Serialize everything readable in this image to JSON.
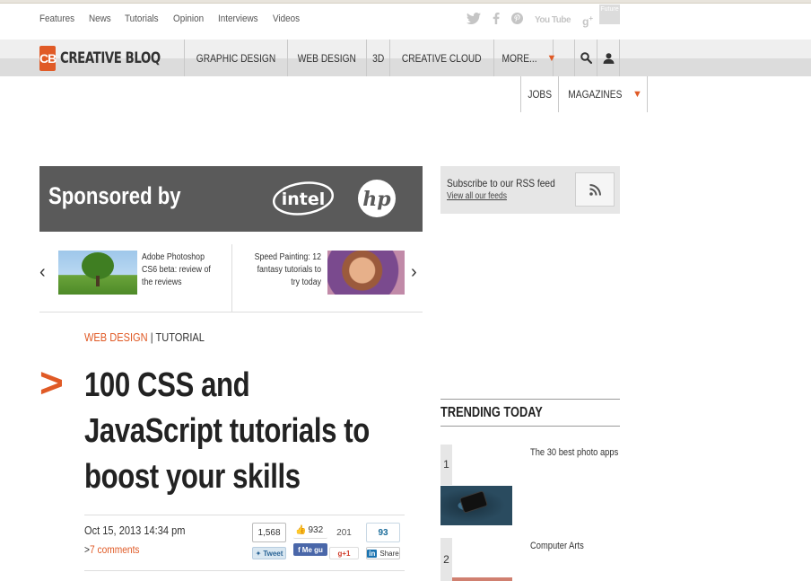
{
  "utility_nav": [
    "Features",
    "News",
    "Tutorials",
    "Opinion",
    "Interviews",
    "Videos"
  ],
  "social_icons": [
    "twitter-icon",
    "facebook-icon",
    "pinterest-icon",
    "youtube-icon",
    "google-plus-icon"
  ],
  "youtube_label": "You Tube",
  "future_label": "Future",
  "logo": {
    "mark": "CB",
    "text": "CREATIVE BLOQ"
  },
  "main_nav": [
    "GRAPHIC DESIGN",
    "WEB DESIGN",
    "3D",
    "CREATIVE CLOUD"
  ],
  "more_label": "MORE...",
  "sub_nav": {
    "jobs": "JOBS",
    "magazines": "MAGAZINES"
  },
  "sponsor": {
    "label": "Sponsored by",
    "brands": [
      "intel",
      "hp"
    ]
  },
  "rss": {
    "title": "Subscribe to our RSS feed",
    "link": "View all our feeds"
  },
  "related": [
    {
      "caption": "Adobe Photoshop CS6 beta: review of the reviews"
    },
    {
      "caption": "Speed Painting: 12 fantasy tutorials to try today"
    }
  ],
  "article": {
    "category": "WEB DESIGN",
    "separator": "|",
    "type": "TUTORIAL",
    "title": "100 CSS and JavaScript tutorials to boost your skills",
    "date": "Oct 15, 2013  14:34 pm",
    "comments_prefix": ">",
    "comments": "7 comments"
  },
  "share": {
    "twitter": {
      "count": "1,568",
      "label": "Tweet"
    },
    "facebook": {
      "count": "932",
      "label": "Me gu"
    },
    "gplus": {
      "count": "201",
      "label": "+1"
    },
    "linkedin": {
      "count": "93",
      "label": "Share",
      "badge": "in"
    }
  },
  "trending": {
    "heading": "TRENDING TODAY",
    "items": [
      {
        "rank": "1",
        "title": "The 30 best photo apps"
      },
      {
        "rank": "2",
        "title": "Computer Arts"
      }
    ]
  },
  "colors": {
    "accent": "#e05a26",
    "nav_bg": "#dcdcdc",
    "sponsor_bg": "#5a5a5a"
  }
}
